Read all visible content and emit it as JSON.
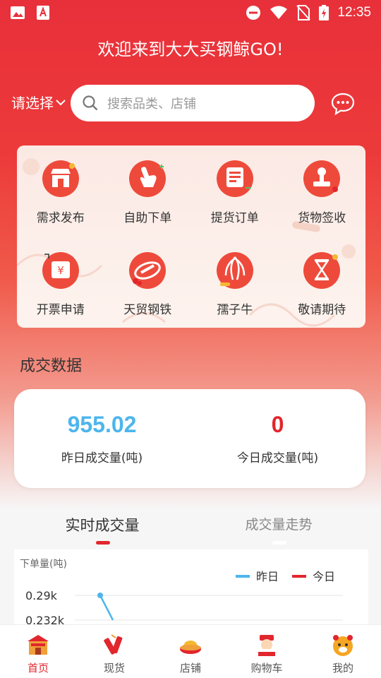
{
  "status_bar": {
    "time": "12:35"
  },
  "header": {
    "title": "欢迎来到大大买钢鲸GO!"
  },
  "search": {
    "region_label": "请选择",
    "placeholder": "搜索品类、店铺"
  },
  "menu": {
    "items": [
      {
        "label": "需求发布",
        "icon": "shop-icon"
      },
      {
        "label": "自助下单",
        "icon": "hand-icon"
      },
      {
        "label": "提货订单",
        "icon": "document-icon"
      },
      {
        "label": "货物签收",
        "icon": "stamp-icon"
      },
      {
        "label": "开票申请",
        "icon": "invoice-icon"
      },
      {
        "label": "天贸钢铁",
        "icon": "tianmao-logo-icon"
      },
      {
        "label": "孺子牛",
        "icon": "ox-logo-icon"
      },
      {
        "label": "敬请期待",
        "icon": "hourglass-icon"
      }
    ]
  },
  "transactions": {
    "section_title": "成交数据",
    "yesterday": {
      "value": "955.02",
      "label": "昨日成交量(吨)"
    },
    "today": {
      "value": "0",
      "label": "今日成交量(吨)"
    }
  },
  "tabs": [
    {
      "label": "实时成交量",
      "active": true
    },
    {
      "label": "成交量走势",
      "active": false
    }
  ],
  "chart_data": {
    "type": "line",
    "ylabel": "下单量(吨)",
    "y_ticks": [
      "0.29k",
      "0.232k"
    ],
    "legend": [
      {
        "name": "昨日",
        "color": "#4db6ec"
      },
      {
        "name": "今日",
        "color": "#e2262d"
      }
    ],
    "series": [
      {
        "name": "昨日",
        "values": [
          0.29,
          0.232
        ]
      }
    ],
    "ylim": [
      0.232,
      0.29
    ]
  },
  "bottom_nav": {
    "items": [
      {
        "label": "首页",
        "icon": "home-icon",
        "active": true
      },
      {
        "label": "现货",
        "icon": "firecracker-icon",
        "active": false
      },
      {
        "label": "店铺",
        "icon": "gold-ingot-icon",
        "active": false
      },
      {
        "label": "购物车",
        "icon": "fortune-god-icon",
        "active": false
      },
      {
        "label": "我的",
        "icon": "tiger-icon",
        "active": false
      }
    ]
  },
  "colors": {
    "brand_red": "#e2262d",
    "blue": "#4db6ec"
  }
}
